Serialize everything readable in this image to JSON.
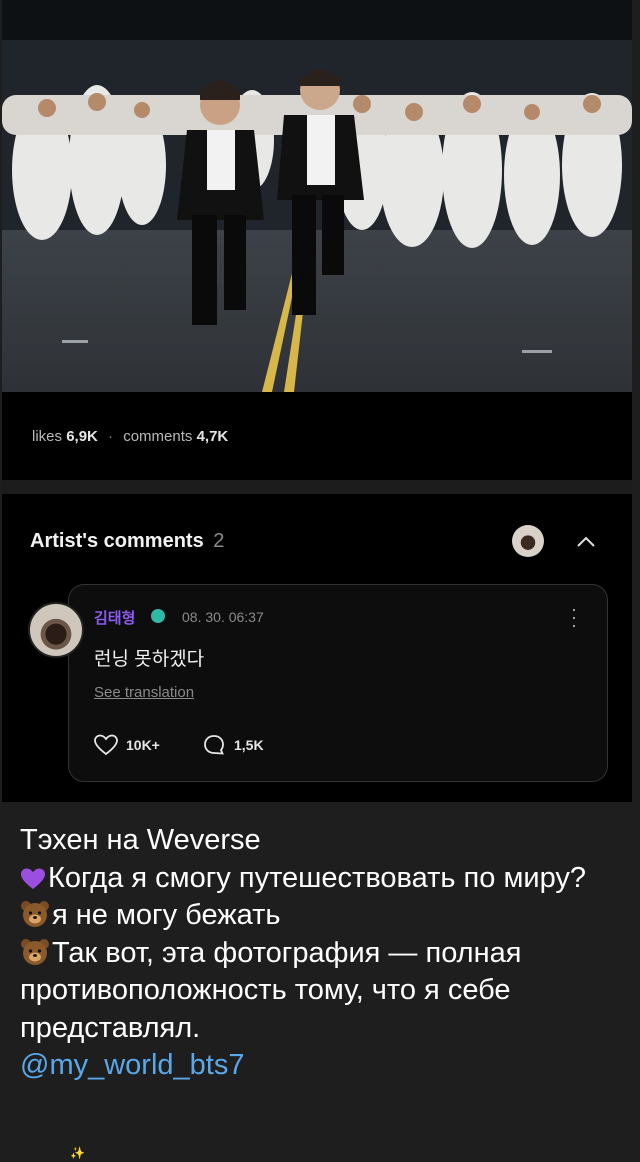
{
  "post": {
    "likes_label": "likes",
    "likes_value": "6,9K",
    "separator": "·",
    "comments_label": "comments",
    "comments_value": "4,7K"
  },
  "artist_comments": {
    "title": "Artist's comments",
    "count": "2",
    "comment": {
      "author": "김태형",
      "date": "08. 30. 06:37",
      "text": "런닝 못하겠다",
      "translate_link": "See translation",
      "likes": "10K+",
      "replies": "1,5K"
    }
  },
  "caption": {
    "line1": "Тэхен на Weverse",
    "line2_emoji": "purple-heart-icon",
    "line2": "Когда я смогу путешествовать по миру?",
    "line3_emoji": "bear-icon",
    "line3": "я не могу бежать",
    "line4_emoji": "bear-icon",
    "line4": "Так вот, эта фотография — полная противоположность тому, что я себе представлял.",
    "mention": "@my_world_bts7",
    "sparkle": "✨"
  },
  "colors": {
    "background": "#1e1e1e",
    "card": "#000000",
    "author": "#8d5bf0",
    "mention": "#5aa7ea",
    "verified": "#2fb9a7"
  }
}
